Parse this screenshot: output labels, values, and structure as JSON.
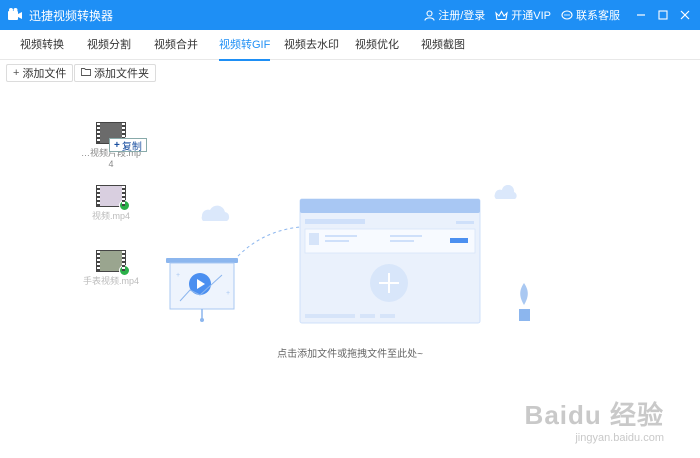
{
  "app": {
    "title": "迅捷视频转换器"
  },
  "header": {
    "login": "注册/登录",
    "vip": "开通VIP",
    "support": "联系客服"
  },
  "tabs": [
    {
      "label": "视频转换"
    },
    {
      "label": "视频分割"
    },
    {
      "label": "视频合并"
    },
    {
      "label": "视频转GIF",
      "active": true
    },
    {
      "label": "视频去水印"
    },
    {
      "label": "视频优化"
    },
    {
      "label": "视频截图"
    }
  ],
  "toolbar": {
    "add_file": "添加文件",
    "add_folder": "添加文件夹"
  },
  "drag": {
    "copy_label": "复制",
    "files": [
      {
        "name": "…视频片段.mp4"
      },
      {
        "name": "视频.mp4"
      },
      {
        "name": "手表视频.mp4"
      }
    ]
  },
  "main": {
    "hint": "点击添加文件或拖拽文件至此处~"
  },
  "watermark": {
    "logo": "Baidu 经验",
    "url": "jingyan.baidu.com"
  },
  "colors": {
    "accent": "#1e8ff5",
    "illustration": "#cfe0fa"
  }
}
